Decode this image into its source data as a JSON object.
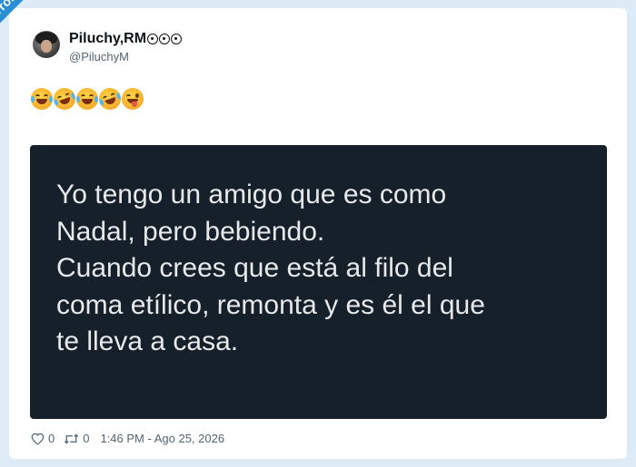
{
  "watermark": "VISTOENLASREDES",
  "author": {
    "name": "Piluchy,RM",
    "badges": [
      "soccer-ball-icon",
      "soccer-ball-icon",
      "soccer-ball-icon"
    ],
    "handle": "@PiluchyM"
  },
  "tweet": {
    "emojis": [
      "tears-of-joy",
      "rolling-on-floor-laughing",
      "tears-of-joy",
      "rolling-on-floor-laughing",
      "winking-face-with-tongue"
    ]
  },
  "quote": {
    "lines": [
      "Yo tengo un amigo que es como",
      "Nadal, pero bebiendo.",
      "Cuando crees que está al filo del",
      "coma etílico, remonta y es él el que",
      "te lleva a casa."
    ]
  },
  "footer": {
    "likes": "0",
    "retweets": "0",
    "timestamp": "1:46 PM - Ago 25, 2026"
  },
  "colors": {
    "page_bg": "#dcebf6",
    "ribbon": "#2b8fd6",
    "quote_bg": "#15202b",
    "quote_text": "#e7e9ea",
    "muted": "#536471"
  }
}
